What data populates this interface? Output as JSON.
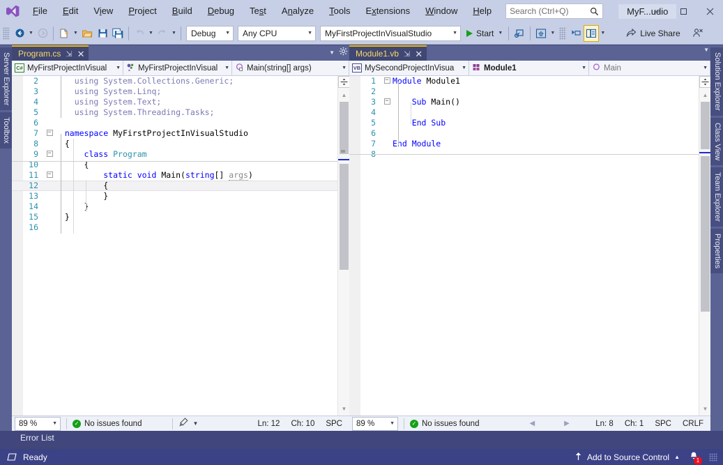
{
  "titlebar": {
    "logo_icon": "visual-studio-logo",
    "menus": [
      "File",
      "Edit",
      "View",
      "Project",
      "Build",
      "Debug",
      "Test",
      "Analyze",
      "Tools",
      "Extensions",
      "Window",
      "Help"
    ],
    "search_placeholder": "Search (Ctrl+Q)",
    "search_icon": "search-icon",
    "window_title": "MyF...udio",
    "minimize_label": "─",
    "maximize_label": "☐",
    "close_label": "✕"
  },
  "toolbar": {
    "back_icon": "navigate-back-icon",
    "forward_icon": "navigate-forward-icon",
    "new_project_icon": "new-project-icon",
    "open_file_icon": "open-file-icon",
    "save_icon": "save-icon",
    "save_all_icon": "save-all-icon",
    "undo_icon": "undo-icon",
    "redo_icon": "redo-icon",
    "configuration": "Debug",
    "platform": "Any CPU",
    "startup_project": "MyFirstProjectInVisualStudio",
    "start_label": "Start",
    "start_icon": "play-icon",
    "attach_icon": "attach-to-process-icon",
    "home_icon": "home-icon",
    "toolwindow_icon": "tool-window-icon",
    "properties_window_icon": "properties-window-icon",
    "live_share_label": "Live Share",
    "live_share_icon": "live-share-icon",
    "feedback_icon": "send-feedback-icon"
  },
  "dock_left": [
    "Server Explorer",
    "Toolbox"
  ],
  "dock_right": [
    "Solution Explorer",
    "Class View",
    "Team Explorer",
    "Properties"
  ],
  "left_pane": {
    "tab": {
      "title": "Program.cs",
      "pin_icon": "pin-icon",
      "close_icon": "close-icon"
    },
    "tabstrip_menu_icon": "chevron-down-icon",
    "tabstrip_gear_icon": "gear-icon",
    "navbar": {
      "project": "MyFirstProjectInVisual",
      "project_badge": "C#",
      "type": "MyFirstProjectInVisual",
      "type_icon": "class-icon",
      "member": "Main(string[] args)",
      "member_icon": "method-icon",
      "caret": "▾"
    },
    "code": [
      {
        "num": "2",
        "fold": "",
        "segs": [
          {
            "c": "u",
            "t": "    using System.Collections.Generic;"
          }
        ]
      },
      {
        "num": "3",
        "fold": "",
        "segs": [
          {
            "c": "u",
            "t": "    using System.Linq;"
          }
        ]
      },
      {
        "num": "4",
        "fold": "",
        "segs": [
          {
            "c": "u",
            "t": "    using System.Text;"
          }
        ]
      },
      {
        "num": "5",
        "fold": "",
        "segs": [
          {
            "c": "u",
            "t": "    using System.Threading.Tasks;"
          }
        ]
      },
      {
        "num": "6",
        "fold": "",
        "segs": [
          {
            "c": "m",
            "t": ""
          }
        ]
      },
      {
        "num": "7",
        "fold": "minus",
        "segs": [
          {
            "c": "k",
            "t": "  namespace "
          },
          {
            "c": "m",
            "t": "MyFirstProjectInVisualStudio"
          }
        ]
      },
      {
        "num": "8",
        "fold": "",
        "segs": [
          {
            "c": "m",
            "t": "  {"
          }
        ]
      },
      {
        "num": "9",
        "fold": "minus",
        "segs": [
          {
            "c": "k",
            "t": "      class "
          },
          {
            "c": "t",
            "t": "Program"
          }
        ]
      },
      {
        "num": "10",
        "fold": "",
        "segs": [
          {
            "c": "m",
            "t": "      {"
          }
        ]
      },
      {
        "num": "11",
        "fold": "minus",
        "segs": [
          {
            "c": "k",
            "t": "          static void "
          },
          {
            "c": "m",
            "t": "Main("
          },
          {
            "c": "k",
            "t": "string"
          },
          {
            "c": "m",
            "t": "[] "
          },
          {
            "c": "arg",
            "t": "args"
          },
          {
            "c": "m",
            "t": ")"
          }
        ]
      },
      {
        "num": "12",
        "fold": "",
        "cur": true,
        "segs": [
          {
            "c": "m",
            "t": "          {"
          }
        ]
      },
      {
        "num": "13",
        "fold": "",
        "segs": [
          {
            "c": "m",
            "t": "          }"
          }
        ]
      },
      {
        "num": "14",
        "fold": "",
        "segs": [
          {
            "c": "m",
            "t": "      }"
          }
        ]
      },
      {
        "num": "15",
        "fold": "",
        "segs": [
          {
            "c": "m",
            "t": "  }"
          }
        ]
      },
      {
        "num": "16",
        "fold": "",
        "segs": [
          {
            "c": "m",
            "t": ""
          }
        ]
      }
    ],
    "status": {
      "zoom": "89 %",
      "issues": "No issues found",
      "issues_icon": "check-circle-icon",
      "brush_icon": "code-cleanup-icon",
      "brush_caret": "▾",
      "line": "Ln: 12",
      "col": "Ch: 10",
      "spaces": "SPC"
    }
  },
  "right_pane": {
    "tab": {
      "title": "Module1.vb",
      "pin_icon": "pin-icon",
      "close_icon": "close-icon"
    },
    "tabstrip_menu_icon": "chevron-down-icon",
    "navbar": {
      "project": "MySecondProjectInVisua",
      "project_badge": "VB",
      "type": "Module1",
      "type_icon": "module-icon",
      "member": "Main",
      "member_icon": "method-icon",
      "caret": "▾"
    },
    "code": [
      {
        "num": "1",
        "fold": "minus",
        "segs": [
          {
            "c": "vbk",
            "t": "Module "
          },
          {
            "c": "m",
            "t": "Module1"
          }
        ]
      },
      {
        "num": "2",
        "fold": "",
        "segs": [
          {
            "c": "m",
            "t": ""
          }
        ]
      },
      {
        "num": "3",
        "fold": "minus",
        "segs": [
          {
            "c": "vbk",
            "t": "    Sub "
          },
          {
            "c": "m",
            "t": "Main()"
          }
        ]
      },
      {
        "num": "4",
        "fold": "",
        "segs": [
          {
            "c": "m",
            "t": ""
          }
        ]
      },
      {
        "num": "5",
        "fold": "",
        "segs": [
          {
            "c": "vbk",
            "t": "    End Sub"
          }
        ]
      },
      {
        "num": "6",
        "fold": "",
        "segs": [
          {
            "c": "m",
            "t": ""
          }
        ]
      },
      {
        "num": "7",
        "fold": "",
        "segs": [
          {
            "c": "vbk",
            "t": "End Module"
          }
        ]
      },
      {
        "num": "8",
        "fold": "",
        "segs": [
          {
            "c": "m",
            "t": ""
          }
        ]
      }
    ],
    "status": {
      "zoom": "89 %",
      "issues": "No issues found",
      "issues_icon": "check-circle-icon",
      "prev_icon": "previous-issue-icon",
      "next_icon": "next-issue-icon",
      "line": "Ln: 8",
      "col": "Ch: 1",
      "spaces": "SPC",
      "lineending": "CRLF"
    }
  },
  "error_list": {
    "tab_label": "Error List"
  },
  "statusbar": {
    "ready": "Ready",
    "ready_icon": "build-status-icon",
    "source_control": "Add to Source Control",
    "source_control_icon": "upload-arrow-icon",
    "source_control_caret": "▴",
    "notifications_icon": "bell-icon",
    "notification_count": "1",
    "resize_grip_icon": "resize-grip-icon"
  },
  "colors": {
    "chrome": "#c6cfe5",
    "shell": "#41477c",
    "tab_accent": "#f2b705",
    "statusbar": "#3b4286",
    "keyword": "#0000ff",
    "type": "#2b91af",
    "using": "#7a7ab5",
    "ok_green": "#16a016",
    "badge_red": "#e81123"
  }
}
